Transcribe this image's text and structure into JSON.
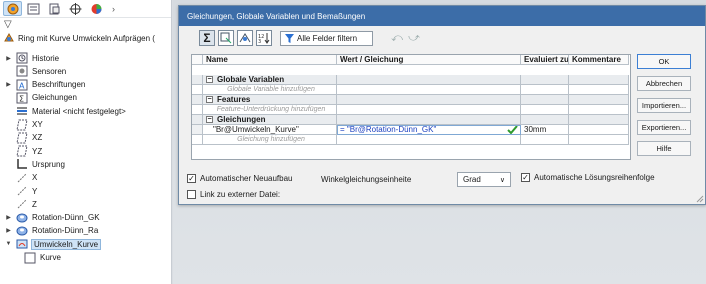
{
  "tree": {
    "filter_symbol": "▽",
    "root_label": "Ring mit Kurve Umwickeln Aufprägen (",
    "items": [
      {
        "label": "Historie",
        "icon": "history-icon",
        "arrow": "▶"
      },
      {
        "label": "Sensoren",
        "icon": "sensor-icon",
        "arrow": ""
      },
      {
        "label": "Beschriftungen",
        "icon": "annotation-icon",
        "arrow": "▶"
      },
      {
        "label": "Gleichungen",
        "icon": "equation-icon",
        "arrow": ""
      },
      {
        "label": "Material <nicht festgelegt>",
        "icon": "material-icon",
        "arrow": ""
      },
      {
        "label": "XY",
        "icon": "plane-icon",
        "arrow": ""
      },
      {
        "label": "XZ",
        "icon": "plane-icon",
        "arrow": ""
      },
      {
        "label": "YZ",
        "icon": "plane-icon",
        "arrow": ""
      },
      {
        "label": "Ursprung",
        "icon": "origin-icon",
        "arrow": ""
      },
      {
        "label": "X",
        "icon": "axis-icon",
        "arrow": ""
      },
      {
        "label": "Y",
        "icon": "axis-icon",
        "arrow": ""
      },
      {
        "label": "Z",
        "icon": "axis-icon",
        "arrow": ""
      },
      {
        "label": "Rotation-Dünn_GK",
        "icon": "revolve-icon",
        "arrow": "▶"
      },
      {
        "label": "Rotation-Dünn_Ra",
        "icon": "revolve-icon",
        "arrow": "▶"
      },
      {
        "label": "Umwickeln_Kurve",
        "icon": "wrap-icon",
        "arrow": "▼"
      },
      {
        "label": "Kurve",
        "icon": "sketch-icon",
        "arrow": ""
      }
    ]
  },
  "dialog": {
    "title": "Gleichungen, Globale Variablen und Bemaßungen",
    "filter_label": "Alle Felder filtern",
    "columns": [
      "Name",
      "Wert / Gleichung",
      "Evaluiert zu",
      "Kommentare"
    ],
    "sections": {
      "globals": "Globale Variablen",
      "globals_add": "Globale Variable hinzufügen",
      "features": "Features",
      "features_add": "Feature-Unterdrückung hinzufügen",
      "equations": "Gleichungen",
      "equations_add": "Gleichung hinzufügen"
    },
    "equation": {
      "name": "\"Br@Umwickeln_Kurve\"",
      "value": "= \"Br@Rotation-Dünn_GK\"",
      "evaluated": "30mm",
      "comment": ""
    },
    "buttons": {
      "ok": "OK",
      "cancel": "Abbrechen",
      "import": "Importieren...",
      "export": "Exportieren...",
      "help": "Hilfe"
    },
    "options": {
      "auto_rebuild": "Automatischer Neuaufbau",
      "auto_rebuild_checked": true,
      "angle_unit_label": "Winkelgleichungseinheite",
      "angle_unit_value": "Grad",
      "auto_order": "Automatische Lösungsreihenfolge",
      "auto_order_checked": true,
      "link_external": "Link zu externer Datei:",
      "link_external_checked": false
    }
  },
  "colors": {
    "title_bar": "#3c6da8",
    "selection": "#cfe3f6",
    "check_green": "#2f9a2f",
    "equation_blue": "#1a3fc0"
  }
}
